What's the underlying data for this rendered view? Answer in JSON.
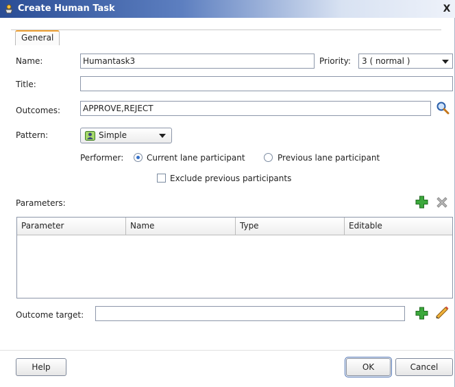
{
  "window": {
    "title": "Create Human Task",
    "close_label": "X"
  },
  "tabs": [
    {
      "label": "General"
    }
  ],
  "form": {
    "name_label": "Name:",
    "name_value": "Humantask3",
    "priority_label": "Priority:",
    "priority_value": "3 ( normal )",
    "title_label": "Title:",
    "title_value": "",
    "outcomes_label": "Outcomes:",
    "outcomes_value": "APPROVE,REJECT",
    "pattern_label": "Pattern:",
    "pattern_value": "Simple",
    "performer_label": "Performer:",
    "performer_options": [
      {
        "label": "Current lane participant",
        "selected": true
      },
      {
        "label": "Previous lane participant",
        "selected": false
      }
    ],
    "exclude_label": "Exclude previous participants",
    "exclude_checked": false,
    "parameters_label": "Parameters:",
    "outcome_target_label": "Outcome target:",
    "outcome_target_value": ""
  },
  "table": {
    "columns": [
      "Parameter",
      "Name",
      "Type",
      "Editable"
    ],
    "rows": []
  },
  "buttons": {
    "help": "Help",
    "ok": "OK",
    "cancel": "Cancel"
  },
  "colors": {
    "accent": "#f0a030",
    "titlebar": "#2a4d95",
    "add": "#2e9a2e"
  },
  "icons": [
    "app-icon",
    "search-icon",
    "add-icon",
    "delete-icon",
    "edit-icon",
    "pattern-user-icon",
    "close-icon"
  ]
}
